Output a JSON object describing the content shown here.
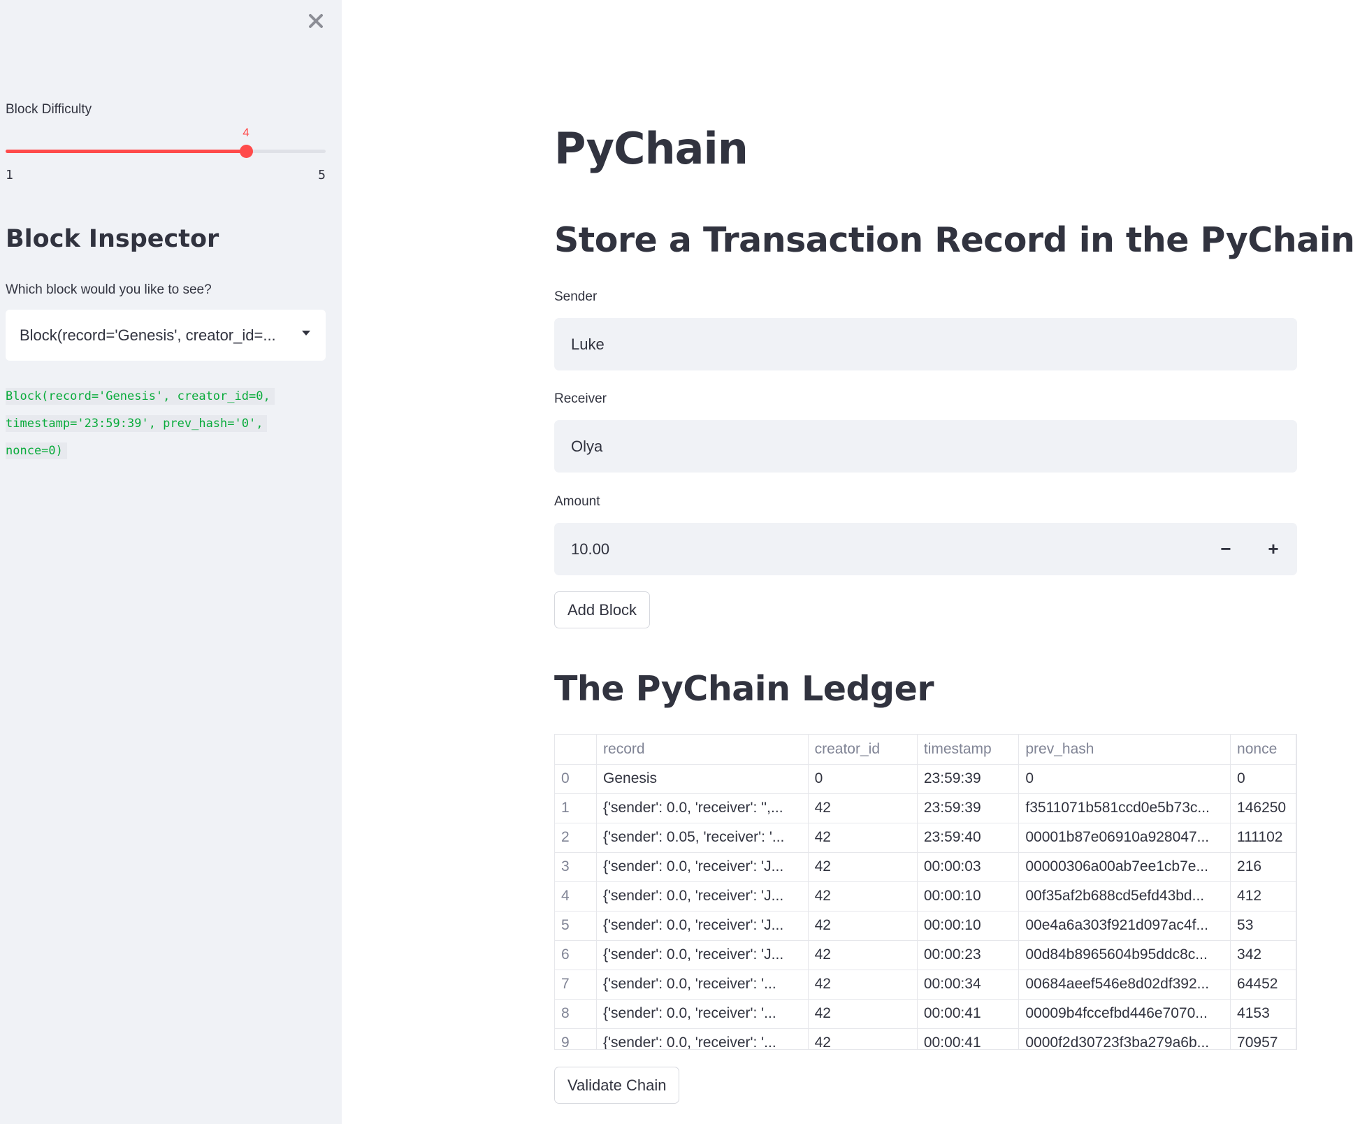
{
  "sidebar": {
    "difficulty_label": "Block Difficulty",
    "slider": {
      "value": "4",
      "min": "1",
      "max": "5"
    },
    "inspector_title": "Block Inspector",
    "select_prompt": "Which block would you like to see?",
    "select_value": "Block(record='Genesis', creator_id=...",
    "code_lines": [
      "Block(record='Genesis', creator_id=0,",
      "timestamp='23:59:39', prev_hash='0',",
      "nonce=0)"
    ]
  },
  "main": {
    "title": "PyChain",
    "subtitle": "Store a Transaction Record in the PyChain",
    "sender": {
      "label": "Sender",
      "value": "Luke"
    },
    "receiver": {
      "label": "Receiver",
      "value": "Olya"
    },
    "amount": {
      "label": "Amount",
      "value": "10.00",
      "minus": "−",
      "plus": "+"
    },
    "add_block_label": "Add Block",
    "ledger_title": "The PyChain Ledger",
    "validate_label": "Validate Chain"
  },
  "table": {
    "columns": [
      "",
      "record",
      "creator_id",
      "timestamp",
      "prev_hash",
      "nonce"
    ],
    "rows": [
      [
        "0",
        "Genesis",
        "0",
        "23:59:39",
        "0",
        "0"
      ],
      [
        "1",
        "{'sender': 0.0, 'receiver': '',...",
        "42",
        "23:59:39",
        "f3511071b581ccd0e5b73c...",
        "146250"
      ],
      [
        "2",
        "{'sender': 0.05, 'receiver': '...",
        "42",
        "23:59:40",
        "00001b87e06910a928047...",
        "111102"
      ],
      [
        "3",
        "{'sender': 0.0, 'receiver': 'J...",
        "42",
        "00:00:03",
        "00000306a00ab7ee1cb7e...",
        "216"
      ],
      [
        "4",
        "{'sender': 0.0, 'receiver': 'J...",
        "42",
        "00:00:10",
        "00f35af2b688cd5efd43bd...",
        "412"
      ],
      [
        "5",
        "{'sender': 0.0, 'receiver': 'J...",
        "42",
        "00:00:10",
        "00e4a6a303f921d097ac4f...",
        "53"
      ],
      [
        "6",
        "{'sender': 0.0, 'receiver': 'J...",
        "42",
        "00:00:23",
        "00d84b8965604b95ddc8c...",
        "342"
      ],
      [
        "7",
        "{'sender': 0.0, 'receiver': '...",
        "42",
        "00:00:34",
        "00684aeef546e8d02df392...",
        "64452"
      ],
      [
        "8",
        "{'sender': 0.0, 'receiver': '...",
        "42",
        "00:00:41",
        "00009b4fccefbd446e7070...",
        "4153"
      ],
      [
        "9",
        "{'sender': 0.0, 'receiver': '...",
        "42",
        "00:00:41",
        "0000f2d30723f3ba279a6b...",
        "70957"
      ]
    ]
  },
  "colors": {
    "accent": "#ff4b4b",
    "sidebar_bg": "#f0f2f6",
    "code_green": "#09ab3b"
  },
  "icons": {
    "close": "close-icon",
    "caret": "chevron-down-icon"
  }
}
